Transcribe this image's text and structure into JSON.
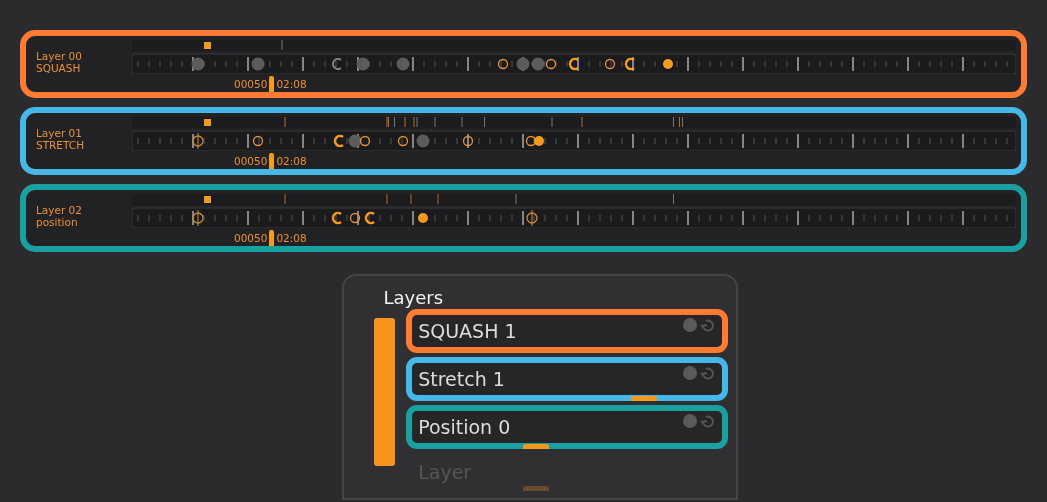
{
  "tracks": [
    {
      "layer": "Layer 00",
      "name": "SQUASH",
      "frame": "00050",
      "time": "02:08",
      "color": "#ff7a33"
    },
    {
      "layer": "Layer 01",
      "name": "STRETCH",
      "frame": "00050",
      "time": "02:08",
      "color": "#45b8e8"
    },
    {
      "layer": "Layer 02",
      "name": "position",
      "frame": "00050",
      "time": "02:08",
      "color": "#1aa0a0"
    }
  ],
  "layers_panel": {
    "title": "Layers",
    "rows": [
      {
        "label": "SQUASH 1",
        "color": "#ff7a33",
        "disabled": false
      },
      {
        "label": "Stretch 1",
        "color": "#45b8e8",
        "disabled": false,
        "level": 0.75
      },
      {
        "label": "Position 0",
        "color": "#1aa0a0",
        "disabled": false,
        "level": 0.4
      },
      {
        "label": "Layer",
        "disabled": true,
        "level": 0.4
      }
    ]
  }
}
